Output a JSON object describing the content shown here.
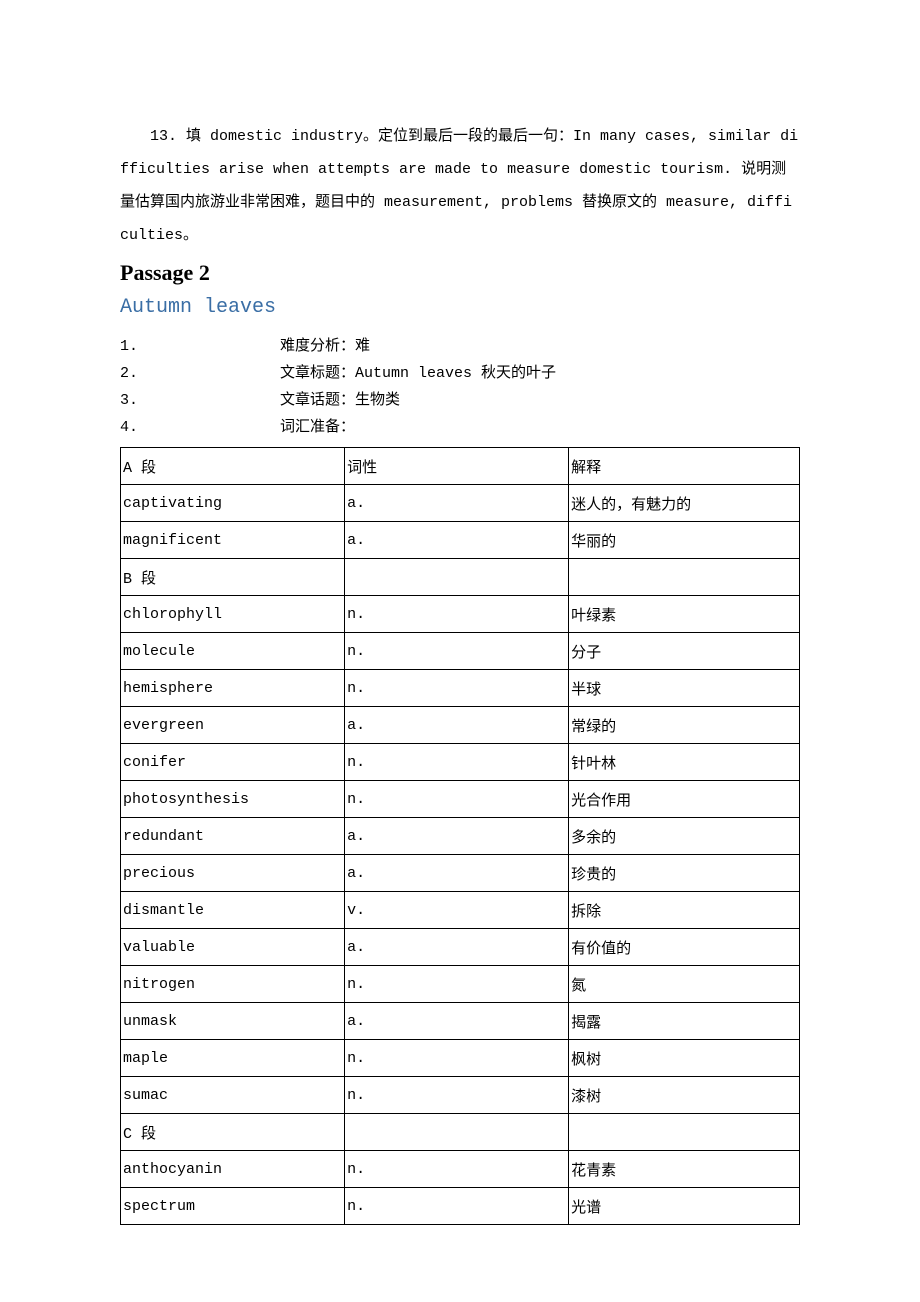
{
  "paragraph": "13. 填 domestic industry。定位到最后一段的最后一句：In many cases, similar difficulties arise when attempts are made to measure domestic tourism. 说明测量估算国内旅游业非常困难，题目中的 measurement, problems 替换原文的 measure, difficulties。",
  "passage_heading": "Passage 2",
  "title": "Autumn leaves",
  "meta": [
    {
      "num": "1.",
      "text": "难度分析：难"
    },
    {
      "num": "2.",
      "text": "文章标题：Autumn leaves 秋天的叶子"
    },
    {
      "num": "3.",
      "text": "文章话题：生物类"
    },
    {
      "num": "4.",
      "text": "词汇准备："
    }
  ],
  "table_header": {
    "c1": "A 段",
    "c2": "词性",
    "c3": "解释"
  },
  "vocab": [
    {
      "c1": "captivating",
      "c2": "a.",
      "c3": "迷人的，有魅力的"
    },
    {
      "c1": "magnificent",
      "c2": "a.",
      "c3": "华丽的"
    },
    {
      "c1": "B 段",
      "c2": "",
      "c3": ""
    },
    {
      "c1": "chlorophyll",
      "c2": "n.",
      "c3": "叶绿素"
    },
    {
      "c1": "molecule",
      "c2": "n.",
      "c3": "分子"
    },
    {
      "c1": "hemisphere",
      "c2": "n.",
      "c3": "半球"
    },
    {
      "c1": "evergreen",
      "c2": "a.",
      "c3": "常绿的"
    },
    {
      "c1": "conifer",
      "c2": "n.",
      "c3": "针叶林"
    },
    {
      "c1": "photosynthesis",
      "c2": "n.",
      "c3": "光合作用"
    },
    {
      "c1": "redundant",
      "c2": "a.",
      "c3": "多余的"
    },
    {
      "c1": "precious",
      "c2": "a.",
      "c3": "珍贵的"
    },
    {
      "c1": "dismantle",
      "c2": "v.",
      "c3": "拆除"
    },
    {
      "c1": "valuable",
      "c2": "a.",
      "c3": "有价值的"
    },
    {
      "c1": "nitrogen",
      "c2": "n.",
      "c3": "氮"
    },
    {
      "c1": "unmask",
      "c2": "a.",
      "c3": "揭露"
    },
    {
      "c1": "maple",
      "c2": "n.",
      "c3": "枫树"
    },
    {
      "c1": "sumac",
      "c2": "n.",
      "c3": "漆树"
    },
    {
      "c1": "C 段",
      "c2": "",
      "c3": ""
    },
    {
      "c1": "anthocyanin",
      "c2": "n.",
      "c3": "花青素"
    },
    {
      "c1": "spectrum",
      "c2": "n.",
      "c3": "光谱"
    }
  ]
}
